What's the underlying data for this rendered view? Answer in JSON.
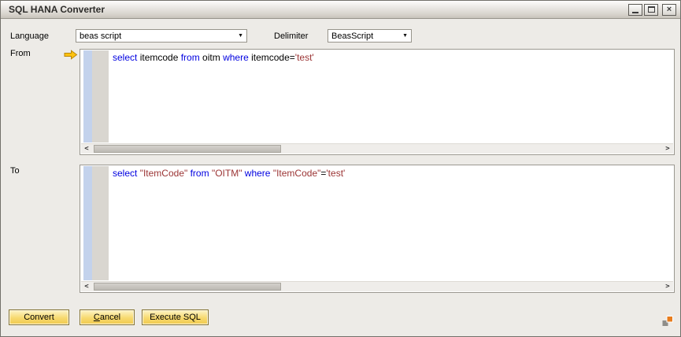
{
  "window": {
    "title": "SQL HANA Converter"
  },
  "toolbar": {
    "language_label": "Language",
    "language_value": "beas script",
    "delimiter_label": "Delimiter",
    "delimiter_value": "BeasScript"
  },
  "from_section": {
    "label": "From",
    "code_tokens": [
      {
        "text": "select",
        "type": "keyword"
      },
      {
        "text": " itemcode ",
        "type": "plain"
      },
      {
        "text": "from",
        "type": "keyword"
      },
      {
        "text": " oitm ",
        "type": "plain"
      },
      {
        "text": "where",
        "type": "keyword"
      },
      {
        "text": " itemcode=",
        "type": "plain"
      },
      {
        "text": "'test'",
        "type": "string"
      }
    ]
  },
  "to_section": {
    "label": "To",
    "code_tokens": [
      {
        "text": "select",
        "type": "keyword"
      },
      {
        "text": " ",
        "type": "plain"
      },
      {
        "text": "\"ItemCode\"",
        "type": "string"
      },
      {
        "text": " ",
        "type": "plain"
      },
      {
        "text": "from",
        "type": "keyword"
      },
      {
        "text": " ",
        "type": "plain"
      },
      {
        "text": "\"OITM\"",
        "type": "string"
      },
      {
        "text": " ",
        "type": "plain"
      },
      {
        "text": "where",
        "type": "keyword"
      },
      {
        "text": " ",
        "type": "plain"
      },
      {
        "text": "\"ItemCode\"",
        "type": "string"
      },
      {
        "text": "=",
        "type": "plain"
      },
      {
        "text": "'test'",
        "type": "string"
      }
    ]
  },
  "buttons": {
    "convert": "Convert",
    "cancel_mnemonic": "C",
    "cancel_rest": "ancel",
    "execute": "Execute SQL"
  },
  "icons": {
    "combo_arrow": "▼",
    "scroll_left": "<",
    "scroll_right": ">",
    "close_glyph": "×"
  },
  "colors": {
    "keyword": "#0000e0",
    "string": "#9b3434",
    "arrow_fill": "#ffc20e",
    "button_gold": "#f0c94d",
    "grip_orange": "#e87d1e"
  }
}
